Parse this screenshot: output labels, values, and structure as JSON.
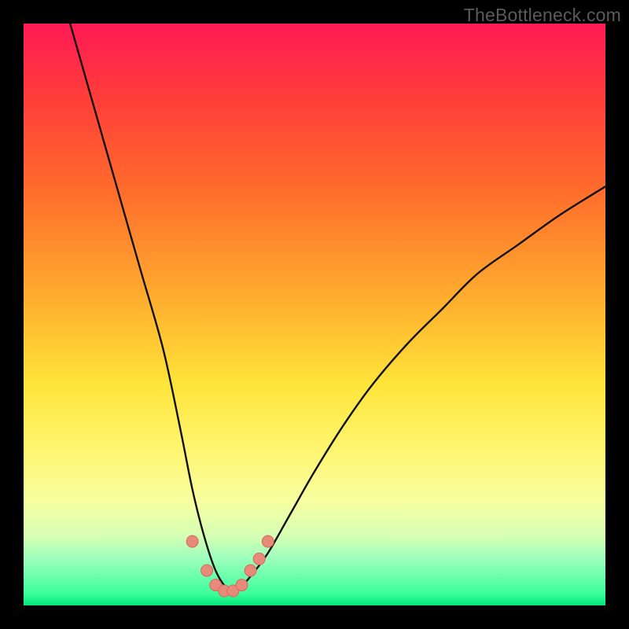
{
  "watermark": "TheBottleneck.com",
  "chart_data": {
    "type": "line",
    "title": "",
    "xlabel": "",
    "ylabel": "",
    "ylim": [
      0,
      100
    ],
    "xlim": [
      0,
      100
    ],
    "series": [
      {
        "name": "curve",
        "x": [
          8,
          12,
          16,
          20,
          24,
          27,
          29,
          31,
          33,
          35,
          37,
          39,
          42,
          46,
          50,
          55,
          60,
          66,
          72,
          78,
          85,
          92,
          100
        ],
        "values": [
          100,
          86,
          72,
          58,
          44,
          30,
          20,
          12,
          6,
          3,
          3,
          5,
          9,
          16,
          23,
          31,
          38,
          45,
          51,
          57,
          62,
          67,
          72
        ]
      }
    ],
    "markers": {
      "name": "highlight-dots",
      "color": "#e88a7a",
      "x": [
        29,
        31.5,
        33,
        34.5,
        36,
        37.5,
        39,
        40.5,
        42
      ],
      "values": [
        11,
        6,
        3.5,
        2.5,
        2.5,
        3.5,
        6,
        8,
        11
      ]
    }
  },
  "colors": {
    "curve_stroke": "#111111",
    "marker_fill": "#e88a7a",
    "marker_stroke": "#d46a5a"
  }
}
